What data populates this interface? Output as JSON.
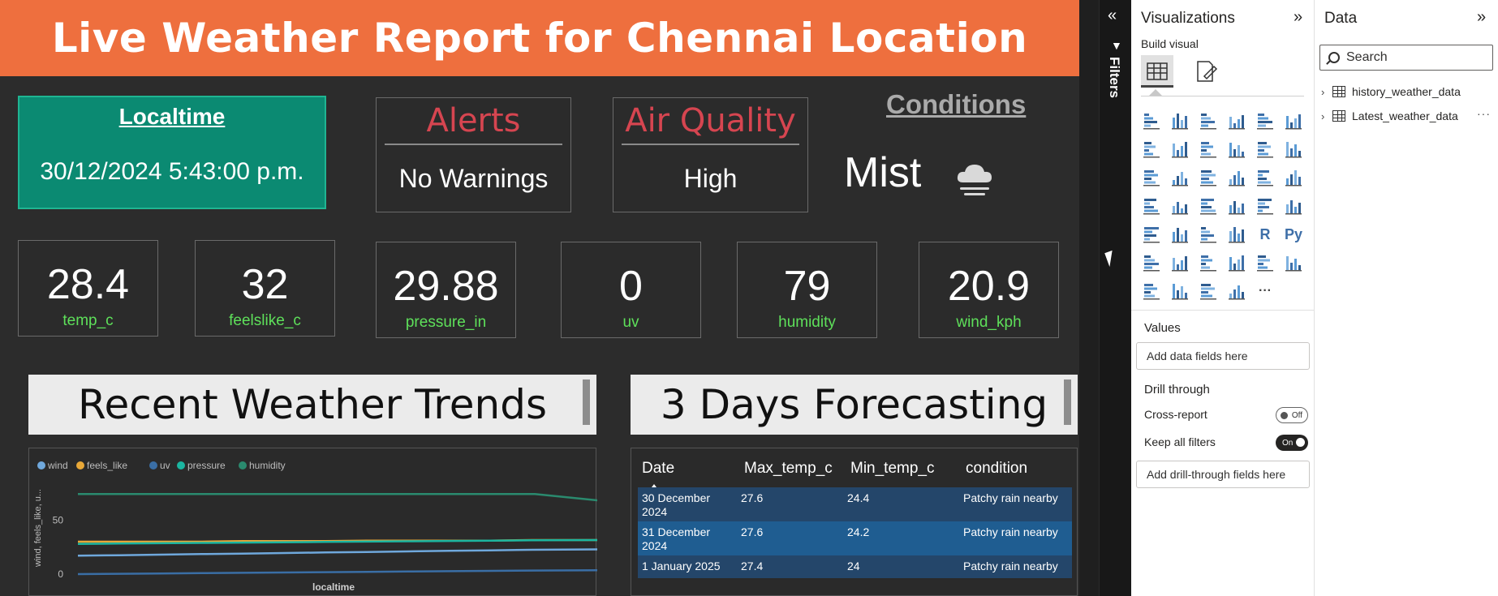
{
  "report": {
    "title": "Live Weather Report for Chennai Location",
    "localtime": {
      "title": "Localtime",
      "value": "30/12/2024 5:43:00 p.m."
    },
    "alerts": {
      "title": "Alerts",
      "value": "No Warnings"
    },
    "air_quality": {
      "title": "Air Quality",
      "value": "High"
    },
    "conditions": {
      "title": "Conditions",
      "value": "Mist",
      "icon": "cloud-mist-icon"
    },
    "kpis": [
      {
        "value": "28.4",
        "label": "temp_c"
      },
      {
        "value": "32",
        "label": "feelslike_c"
      },
      {
        "value": "29.88",
        "label": "pressure_in"
      },
      {
        "value": "0",
        "label": "uv"
      },
      {
        "value": "79",
        "label": "humidity"
      },
      {
        "value": "20.9",
        "label": "wind_kph"
      }
    ],
    "trends_header": "Recent Weather Trends",
    "forecast_header": "3 Days Forecasting",
    "forecast": {
      "columns": [
        "Date",
        "Max_temp_c",
        "Min_temp_c",
        "condition"
      ],
      "rows": [
        {
          "date_line1": "30 December",
          "date_line2": "2024",
          "max": "27.6",
          "min": "24.4",
          "condition": "Patchy rain nearby"
        },
        {
          "date_line1": "31 December",
          "date_line2": "2024",
          "max": "27.6",
          "min": "24.2",
          "condition": "Patchy rain nearby"
        },
        {
          "date_line1": "1 January 2025",
          "date_line2": "",
          "max": "27.4",
          "min": "24",
          "condition": "Patchy rain nearby"
        }
      ]
    },
    "colors": {
      "title_bar": "#ee6f3e",
      "localtime_card": "#0b8a72",
      "alert_red": "#d64550",
      "kpi_label": "#5ee05a"
    }
  },
  "chart_data": {
    "type": "line",
    "xlabel": "localtime",
    "ylabel": "wind, feels_like, u...",
    "ylim": [
      0,
      90
    ],
    "yticks": [
      "0",
      "50"
    ],
    "legend_position": "top-left",
    "series": [
      {
        "name": "wind",
        "color": "#6fa8dc",
        "values": [
          17,
          17.5,
          18,
          18.5,
          19,
          19.5,
          20,
          20.5,
          21,
          21.5,
          22,
          22.5,
          23,
          20.9
        ]
      },
      {
        "name": "feels_like",
        "color": "#e8a838",
        "values": [
          30,
          30,
          30,
          30,
          30.5,
          30.5,
          30.5,
          31,
          31,
          31,
          31,
          31.5,
          31.5,
          34
        ]
      },
      {
        "name": "uv",
        "color": "#3a6ea5",
        "values": [
          0,
          0.3,
          0.6,
          0.9,
          1.2,
          1.5,
          1.8,
          2.1,
          2.4,
          2.7,
          3,
          3.3,
          3.6,
          0
        ]
      },
      {
        "name": "pressure",
        "color": "#1bb5a0",
        "values": [
          28,
          28.3,
          28.6,
          28.9,
          29.2,
          29.5,
          29.8,
          30.1,
          30.4,
          30.7,
          31,
          31.3,
          31.6,
          29.88
        ]
      },
      {
        "name": "humidity",
        "color": "#2a8a6e",
        "values": [
          74,
          74,
          74,
          74,
          74,
          74,
          74,
          74,
          74,
          74,
          74,
          74,
          74,
          66,
          79
        ]
      }
    ]
  },
  "filters": {
    "label": "Filters"
  },
  "visualizations": {
    "title": "Visualizations",
    "build_label": "Build visual",
    "values_label": "Values",
    "values_well": "Add data fields here",
    "drill_label": "Drill through",
    "cross_report_label": "Cross-report",
    "cross_report_state": "Off",
    "keep_filters_label": "Keep all filters",
    "keep_filters_state": "On",
    "drill_well": "Add drill-through fields here",
    "icons": [
      "stacked-bar-icon",
      "stacked-column-icon",
      "clustered-bar-icon",
      "clustered-column-icon",
      "100-bar-icon",
      "100-column-icon",
      "line-chart-icon",
      "area-chart-icon",
      "stacked-area-icon",
      "line-column-icon",
      "line-clustered-icon",
      "ribbon-chart-icon",
      "waterfall-icon",
      "funnel-icon",
      "scatter-icon",
      "pie-chart-icon",
      "donut-chart-icon",
      "treemap-icon",
      "map-icon",
      "filled-map-icon",
      "azure-map-icon",
      "gauge-icon",
      "card-icon",
      "multirow-card-icon",
      "kpi-icon",
      "slicer-icon",
      "table-icon",
      "matrix-icon",
      "r-visual-icon",
      "python-visual-icon",
      "key-influencers-icon",
      "decomposition-tree-icon",
      "qa-icon",
      "narrative-icon",
      "goals-icon",
      "paginated-report-icon",
      "card-new-icon",
      "custom-visual-icon",
      "powerapps-icon",
      "power-automate-icon",
      "more-visuals-icon"
    ],
    "r_glyph": "R",
    "py_glyph": "Py",
    "more_glyph": "···"
  },
  "data_pane": {
    "title": "Data",
    "search_placeholder": "Search",
    "tables": [
      "history_weather_data",
      "Latest_weather_data"
    ],
    "more_glyph": "···"
  }
}
